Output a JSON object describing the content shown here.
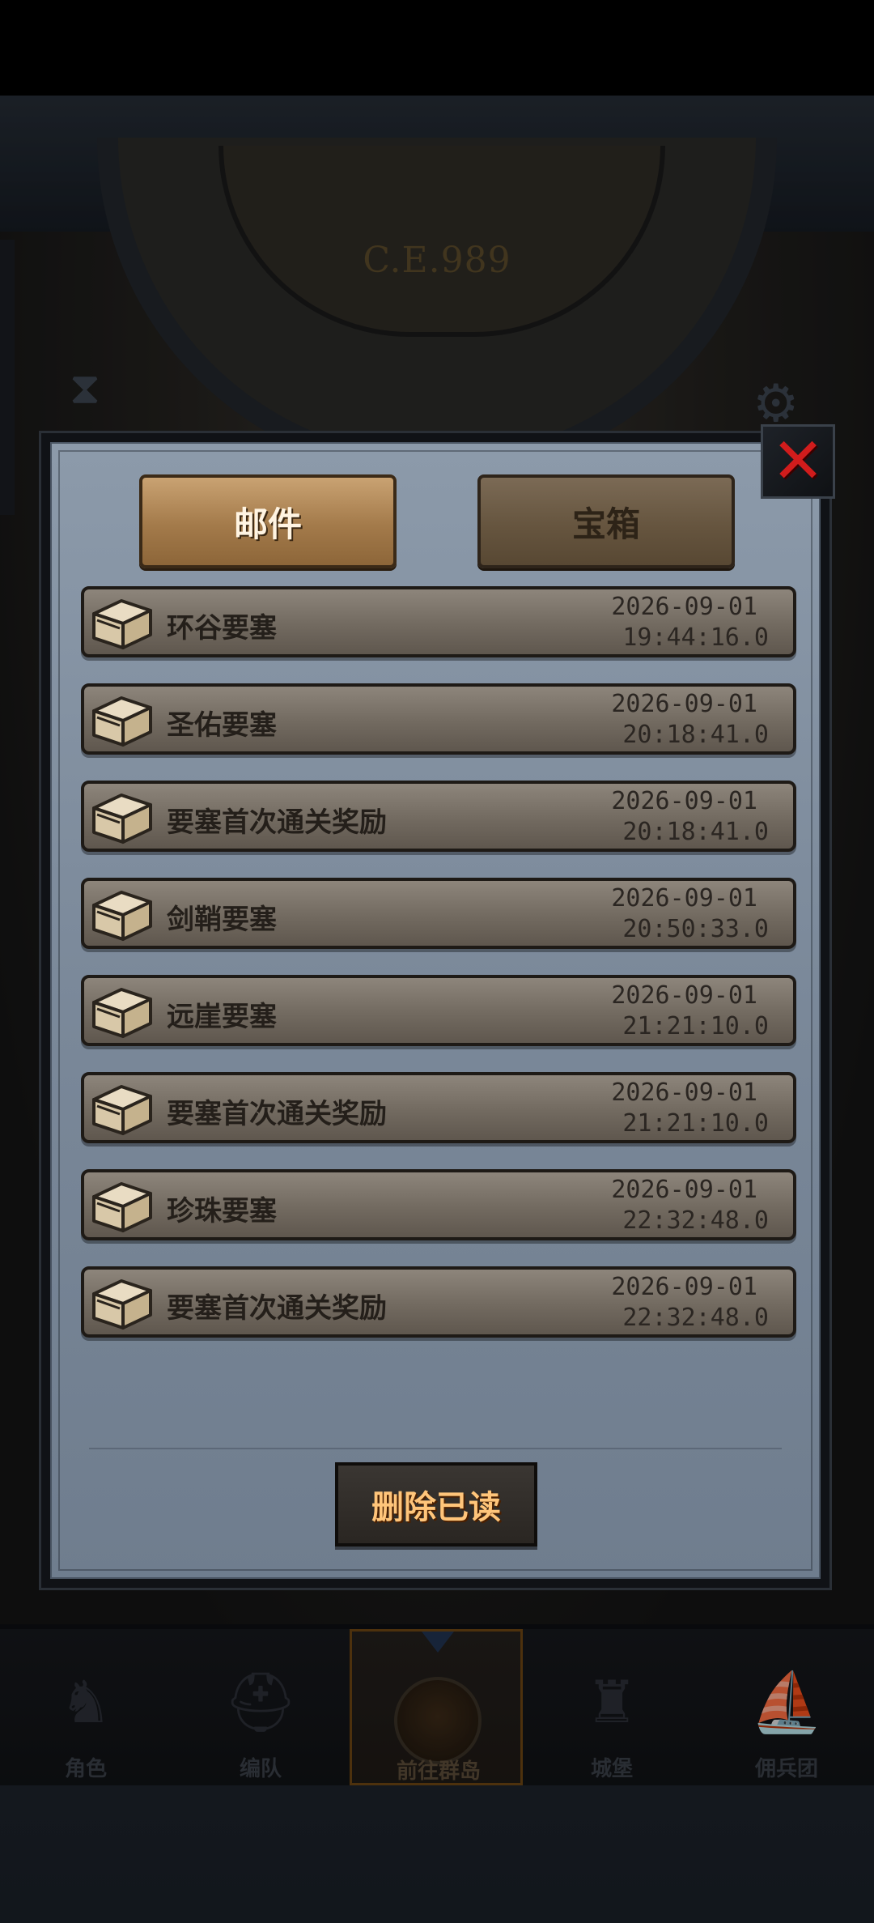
{
  "background": {
    "era_label": "C.E.989",
    "bottom_nav": [
      {
        "label": "角色",
        "icon": "knight-icon",
        "active": false
      },
      {
        "label": "编队",
        "icon": "helmet-icon",
        "active": false
      },
      {
        "label": "前往群岛",
        "icon": "globe-icon",
        "active": true
      },
      {
        "label": "城堡",
        "icon": "castle-icon",
        "active": false
      },
      {
        "label": "佣兵团",
        "icon": "ship-icon",
        "active": false
      }
    ]
  },
  "modal": {
    "tabs": [
      {
        "label": "邮件",
        "active": true
      },
      {
        "label": "宝箱",
        "active": false
      }
    ],
    "close_icon": "close-icon",
    "mails": [
      {
        "title": "环谷要塞",
        "date": "2026-09-01",
        "time": "19:44:16.0"
      },
      {
        "title": "圣佑要塞",
        "date": "2026-09-01",
        "time": "20:18:41.0"
      },
      {
        "title": "要塞首次通关奖励",
        "date": "2026-09-01",
        "time": "20:18:41.0"
      },
      {
        "title": "剑鞘要塞",
        "date": "2026-09-01",
        "time": "20:50:33.0"
      },
      {
        "title": "远崖要塞",
        "date": "2026-09-01",
        "time": "21:21:10.0"
      },
      {
        "title": "要塞首次通关奖励",
        "date": "2026-09-01",
        "time": "21:21:10.0"
      },
      {
        "title": "珍珠要塞",
        "date": "2026-09-01",
        "time": "22:32:48.0"
      },
      {
        "title": "要塞首次通关奖励",
        "date": "2026-09-01",
        "time": "22:32:48.0"
      }
    ],
    "delete_read_label": "删除已读"
  }
}
